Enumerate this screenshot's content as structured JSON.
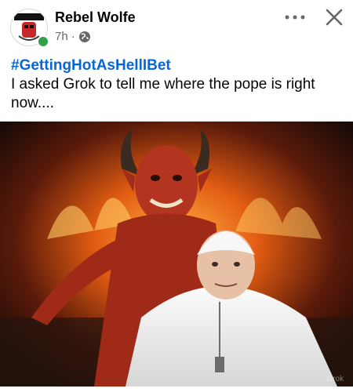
{
  "post": {
    "author": "Rebel Wolfe",
    "time": "7h",
    "separator": "·",
    "hashtag": "#GettingHotAsHellIBet",
    "text": "I asked Grok to tell me where the pope is right now....",
    "image_watermark": "Grok"
  },
  "icons": {
    "privacy": "globe-icon",
    "more": "more-options-icon",
    "close": "close-icon"
  },
  "colors": {
    "hashtag": "#0866d6",
    "online": "#31a24c",
    "meta": "#65676b"
  }
}
